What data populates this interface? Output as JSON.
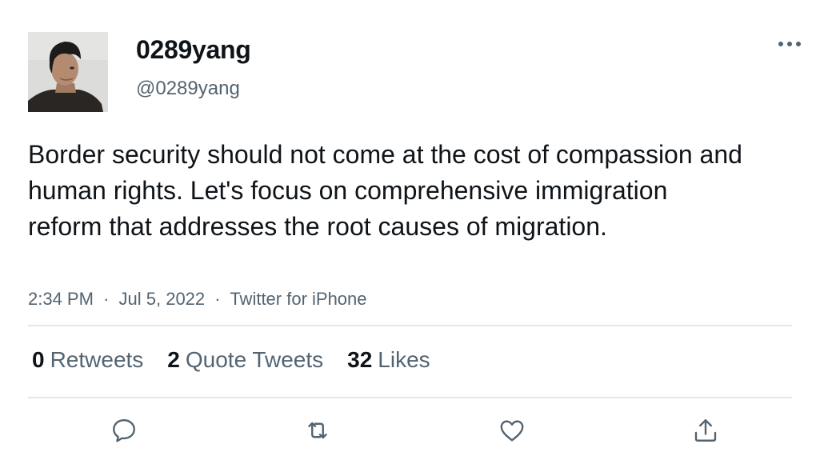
{
  "tweet": {
    "author": {
      "display_name": "0289yang",
      "handle": "@0289yang"
    },
    "text": "Border security should not come at the cost of compassion and human rights. Let's focus on comprehensive immigration reform that addresses the root causes of migration.",
    "meta": {
      "time": "2:34 PM",
      "separator": "·",
      "date": "Jul 5, 2022",
      "source": "Twitter for iPhone"
    },
    "stats": {
      "retweets_count": "0",
      "retweets_label": "Retweets",
      "quotes_count": "2",
      "quotes_label": "Quote Tweets",
      "likes_count": "32",
      "likes_label": "Likes"
    },
    "actions": {
      "reply_icon": "reply-icon",
      "retweet_icon": "retweet-icon",
      "like_icon": "heart-icon",
      "share_icon": "share-icon"
    }
  },
  "colors": {
    "text_primary": "#0f1419",
    "text_secondary": "#536471",
    "divider": "#e3e6e8"
  }
}
